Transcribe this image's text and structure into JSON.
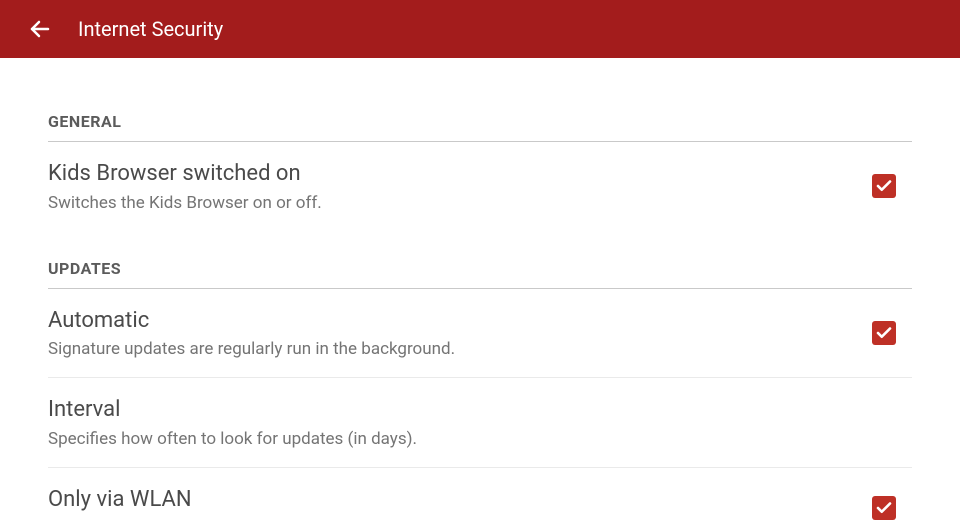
{
  "header": {
    "title": "Internet Security"
  },
  "sections": {
    "general": {
      "label": "GENERAL",
      "items": [
        {
          "title": "Kids Browser switched on",
          "subtitle": "Switches the Kids Browser on or off.",
          "checked": true
        }
      ]
    },
    "updates": {
      "label": "UPDATES",
      "items": [
        {
          "title": "Automatic",
          "subtitle": "Signature updates are regularly run in the background.",
          "checked": true
        },
        {
          "title": "Interval",
          "subtitle": "Specifies how often to look for updates (in days).",
          "checked": null
        },
        {
          "title": "Only via WLAN",
          "subtitle": "",
          "checked": true
        }
      ]
    }
  }
}
